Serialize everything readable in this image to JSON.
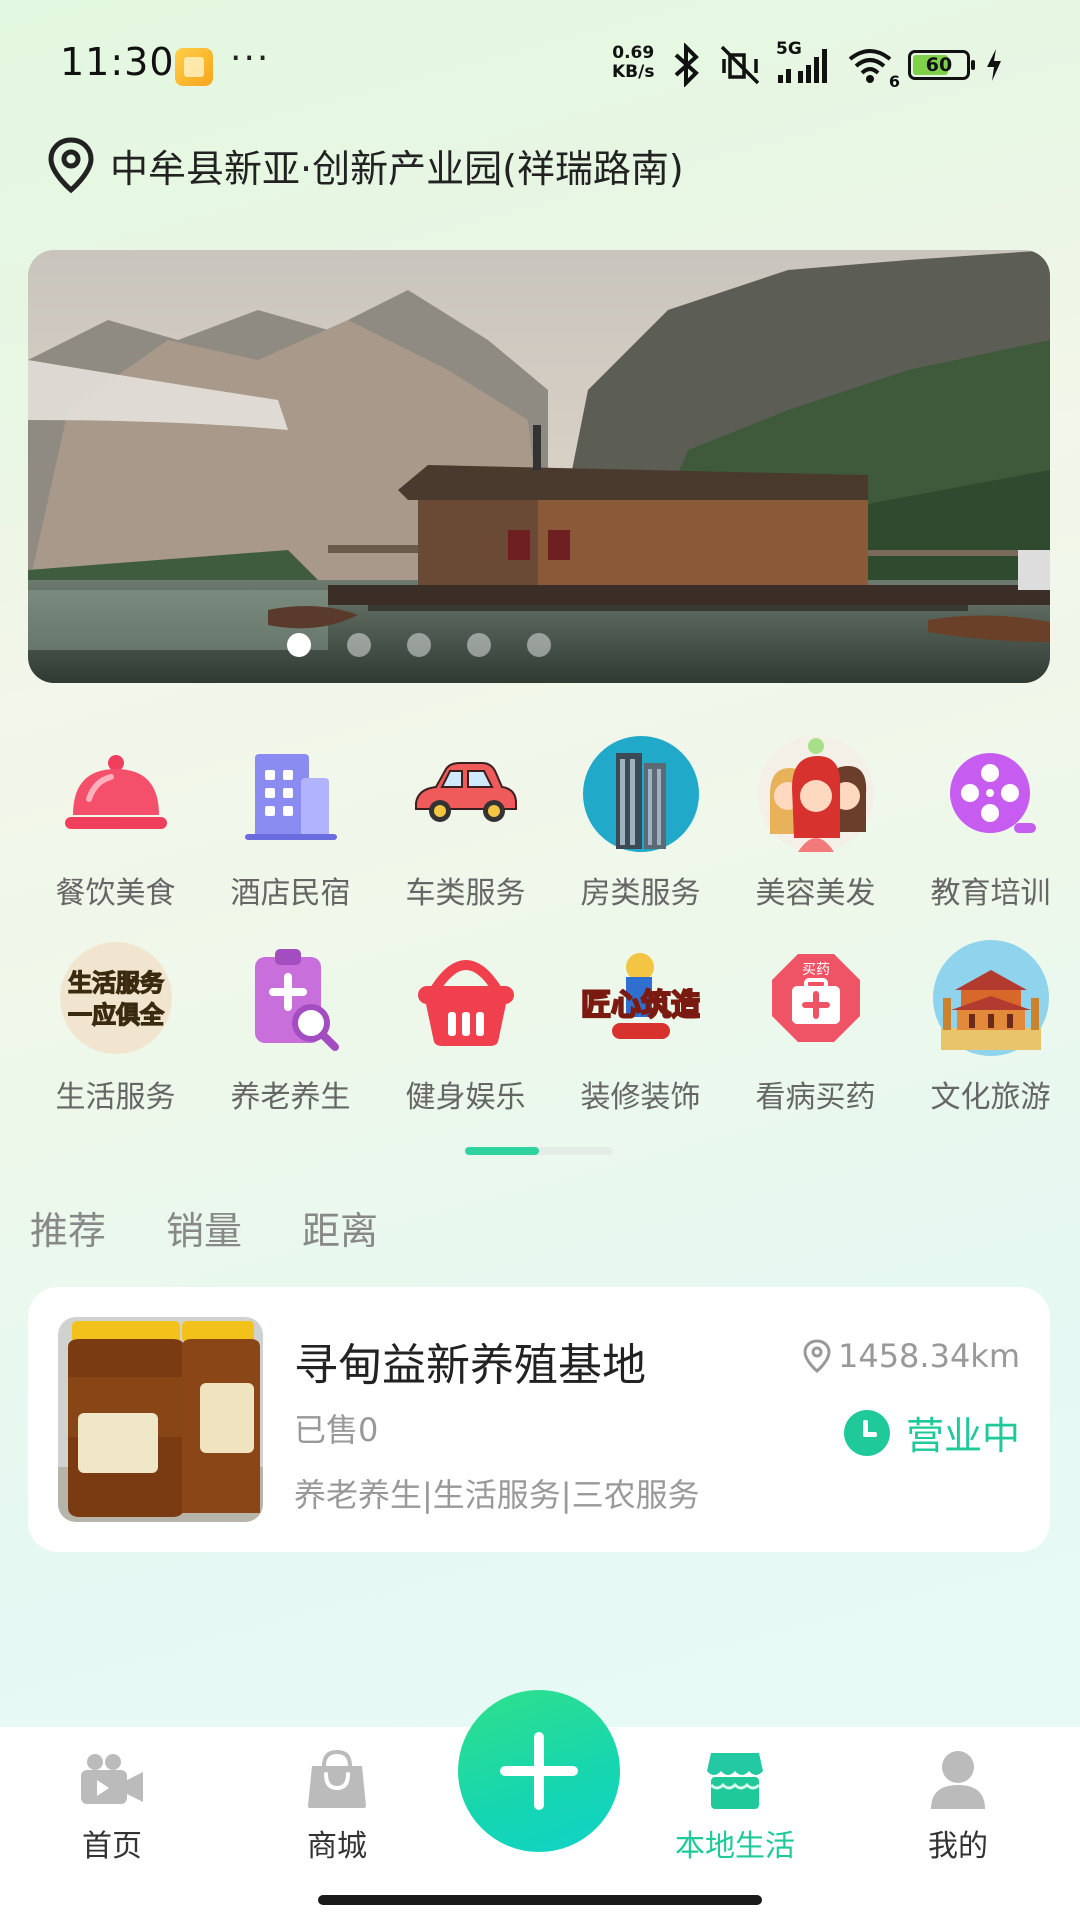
{
  "status_bar": {
    "time": "11:30",
    "net_speed_value": "0.69",
    "net_speed_unit": "KB/s",
    "signal_label": "5G",
    "wifi_label": "6",
    "battery": "60"
  },
  "location": {
    "text": "中牟县新亚·创新产业园(祥瑞路南)"
  },
  "banner": {
    "slide_count": 5,
    "active_index": 0
  },
  "categories": {
    "row1": [
      {
        "label": "餐饮美食",
        "icon": "cloche-icon"
      },
      {
        "label": "酒店民宿",
        "icon": "building-icon"
      },
      {
        "label": "车类服务",
        "icon": "car-icon"
      },
      {
        "label": "房类服务",
        "icon": "skyscraper-icon"
      },
      {
        "label": "美容美发",
        "icon": "beauty-women-icon"
      },
      {
        "label": "教育培训",
        "icon": "film-reel-icon"
      }
    ],
    "row2": [
      {
        "label": "生活服务",
        "icon": "life-service-badge-icon",
        "badge_text": [
          "生活服务",
          "一应俱全"
        ]
      },
      {
        "label": "养老养生",
        "icon": "clipboard-plus-icon"
      },
      {
        "label": "健身娱乐",
        "icon": "basket-icon"
      },
      {
        "label": "装修装饰",
        "icon": "renovation-icon",
        "badge_text": "匠心筑造"
      },
      {
        "label": "看病买药",
        "icon": "medicine-box-icon",
        "badge_text": "买药"
      },
      {
        "label": "文化旅游",
        "icon": "temple-icon"
      }
    ]
  },
  "sort_tabs": [
    "推荐",
    "销量",
    "距离"
  ],
  "shop": {
    "name": "寻甸益新养殖基地",
    "sold": "已售0",
    "tags": "养老养生|生活服务|三农服务",
    "distance": "1458.34km",
    "status": "营业中"
  },
  "bottom_nav": {
    "items": [
      {
        "label": "首页",
        "icon": "video-camera-icon"
      },
      {
        "label": "商城",
        "icon": "shopping-bag-icon"
      },
      {
        "label": "本地生活",
        "icon": "storefront-icon"
      },
      {
        "label": "我的",
        "icon": "user-icon"
      }
    ],
    "active": "本地生活",
    "fab_icon": "plus-icon"
  },
  "colors": {
    "accent": "#1fc99a",
    "indicator_active": "#2ed3a0",
    "fab_gradient_start": "#2fe08a",
    "fab_gradient_end": "#0fd3c8"
  }
}
